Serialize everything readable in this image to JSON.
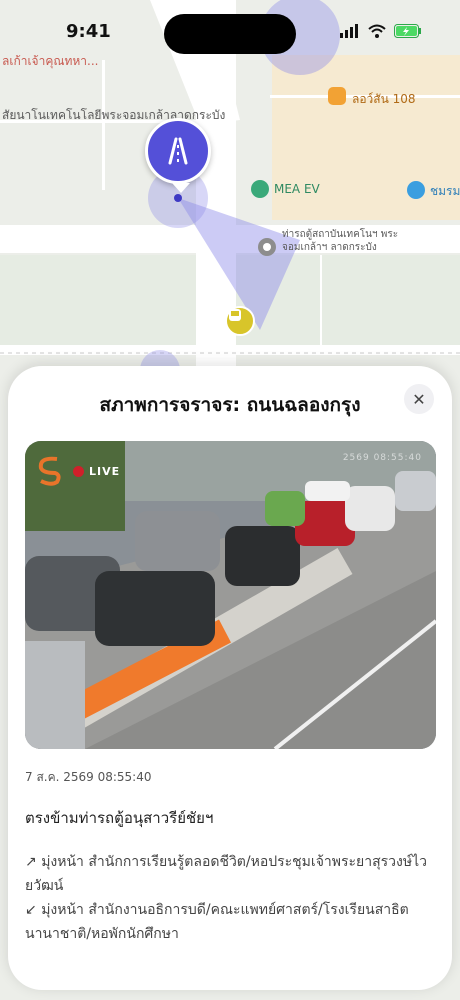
{
  "status_bar": {
    "time": "9:41"
  },
  "map": {
    "labels": {
      "lamu": "ลเก้าเจ้าคุณทหา...",
      "kmitl": "สัยนาโนเทคโนโลยีพระจอมเกล้าลาดกระบัง",
      "lotus": "ลอว์สัน 108",
      "mea": "MEA EV",
      "stop": "ท่ารถตู้สถาบันเทคโนฯ พระจอมเกล้าฯ ลาดกระบัง",
      "club": "ชมรม"
    },
    "colors": {
      "pin": "#5450d8",
      "bus_stop": "#d8c52a",
      "coverage": "#8f8ce8"
    },
    "icons": {
      "pin": "road-icon",
      "bus": "bus-icon",
      "lotus": "shop-icon",
      "mea": "ev-charger-icon",
      "stop": "bus-stop-icon",
      "club": "club-icon"
    }
  },
  "sheet": {
    "title": "สภาพการจราจร: ถนนฉลองกรุง",
    "close_label": "✕",
    "camera": {
      "live_label": "LIVE",
      "stamp": "2569 08:55:40"
    },
    "timestamp": "7 ส.ค. 2569 08:55:40",
    "location": "ตรงข้ามท่ารถตู้อนุสาวรีย์ชัยฯ",
    "directions": [
      {
        "arrow": "↗",
        "text": "มุ่งหน้า สำนักการเรียนรู้ตลอดชีวิต/หอประชุมเจ้าพระยาสุรวงษ์ไวยวัฒน์"
      },
      {
        "arrow": "↙",
        "text": "มุ่งหน้า สำนักงานอธิการบดี/คณะแพทย์ศาสตร์/โรงเรียนสาธิตนานาชาติ/หอพักนักศึกษา"
      }
    ]
  }
}
